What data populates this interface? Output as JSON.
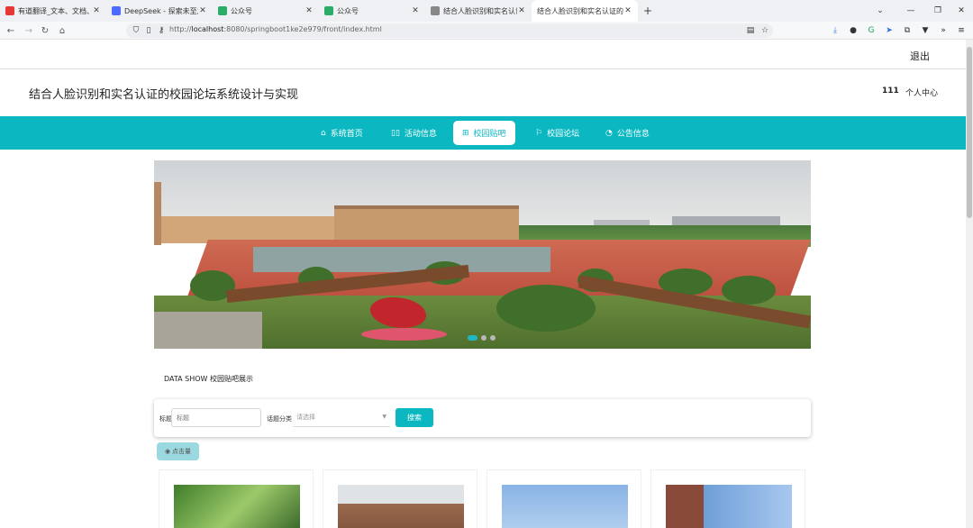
{
  "browser": {
    "tabs": [
      {
        "title": "有道翻译_文本、文档、网页、空",
        "favicon_color": "#e53935",
        "active": false
      },
      {
        "title": "DeepSeek - 探索未至之境",
        "favicon_color": "#4d6bfe",
        "active": false
      },
      {
        "title": "公众号",
        "favicon_color": "#2aae67",
        "active": false
      },
      {
        "title": "公众号",
        "favicon_color": "#2aae67",
        "active": false
      },
      {
        "title": "结合人脸识别和实名认证的校园",
        "favicon_color": "#888888",
        "active": false
      },
      {
        "title": "结合人脸识别和实名认证的校园论坛",
        "favicon_color": "#ffffff",
        "active": true
      }
    ],
    "new_tab_icon": "plus-icon",
    "url_host": "localhost",
    "url_prefix": "http://",
    "url_rest": ":8080/springboot1ke2e979/front/index.html"
  },
  "header": {
    "logout": "退出",
    "site_title": "结合人脸识别和实名认证的校园论坛系统设计与实现",
    "username": "111",
    "user_center": "个人中心"
  },
  "nav": {
    "accent": "#0bb8c1",
    "items": [
      {
        "label": "系统首页",
        "icon": "home-icon",
        "active": false
      },
      {
        "label": "活动信息",
        "icon": "book-icon",
        "active": false
      },
      {
        "label": "校园贴吧",
        "icon": "gift-icon",
        "active": true
      },
      {
        "label": "校园论坛",
        "icon": "flag-icon",
        "active": false
      },
      {
        "label": "公告信息",
        "icon": "gauge-icon",
        "active": false
      }
    ]
  },
  "banner": {
    "slide_count": 3,
    "active_slide": 1
  },
  "section": {
    "title": "DATA SHOW 校园贴吧展示"
  },
  "search": {
    "title_label": "标题",
    "title_placeholder": "标题",
    "category_label": "话题分类",
    "category_placeholder": "请选择",
    "button": "搜索"
  },
  "sort": {
    "label": "点击量",
    "icon": "eye-icon"
  },
  "cards": [
    {
      "scene": "green trees"
    },
    {
      "scene": "brick building"
    },
    {
      "scene": "blue sky building"
    },
    {
      "scene": "campus building"
    }
  ]
}
